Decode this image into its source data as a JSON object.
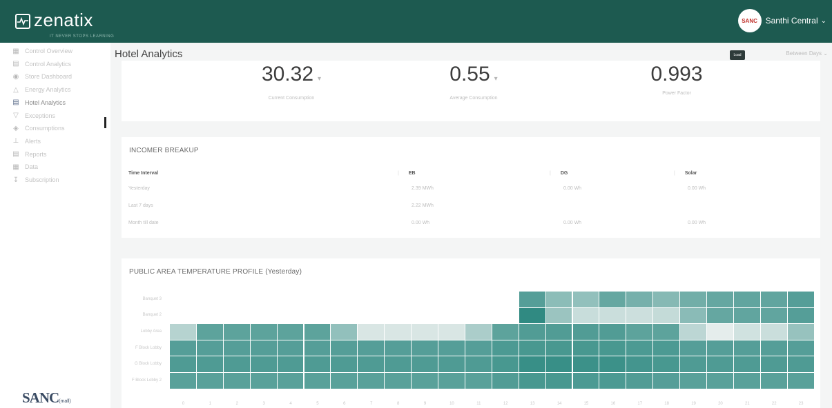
{
  "header": {
    "logo_text": "zenatix",
    "logo_tagline": "IT NEVER STOPS LEARNING",
    "user_name": "Santhi Central",
    "avatar_text": "SANC"
  },
  "sidebar": {
    "items": [
      {
        "label": "Control Overview",
        "icon": "building-icon"
      },
      {
        "label": "Control Analytics",
        "icon": "chart-icon"
      },
      {
        "label": "Store Dashboard",
        "icon": "store-icon"
      },
      {
        "label": "Energy Analytics",
        "icon": "bulb-icon"
      },
      {
        "label": "Hotel Analytics",
        "icon": "chart-icon",
        "active": true
      },
      {
        "label": "Exceptions",
        "icon": "filter-icon"
      },
      {
        "label": "Consumptions",
        "icon": "plug-icon"
      },
      {
        "label": "Alerts",
        "icon": "alert-icon"
      },
      {
        "label": "Reports",
        "icon": "report-icon"
      },
      {
        "label": "Data",
        "icon": "grid-icon"
      },
      {
        "label": "Subscription",
        "icon": "download-icon"
      }
    ],
    "footer_logo": "SANC",
    "footer_logo_sub": "(mall)"
  },
  "page": {
    "title": "Hotel Analytics",
    "top_button": "Load",
    "top_dropdown": "Between Days"
  },
  "kpis": [
    {
      "value": "30.32",
      "label": "Current Consumption",
      "has_arrow": true
    },
    {
      "value": "0.55",
      "label": "Average Consumption",
      "has_arrow": true
    },
    {
      "value": "0.993",
      "label": "Power Factor",
      "has_arrow": false
    }
  ],
  "breakup": {
    "title": "INCOMER BREAKUP",
    "columns": [
      "Time Interval",
      "EB",
      "DG",
      "Solar"
    ],
    "rows": [
      [
        "Yesterday",
        "2.39 MWh",
        "0.00 Wh",
        "0.00 Wh"
      ],
      [
        "Last 7 days",
        "2.22 MWh",
        "",
        ""
      ],
      [
        "Month till date",
        "0.00 Wh",
        "0.00 Wh",
        "0.00 Wh"
      ]
    ]
  },
  "heatmap": {
    "title": "PUBLIC AREA TEMPERATURE PROFILE (Yesterday)",
    "rows": [
      "Banquet 3",
      "Banquet 2",
      "Lobby Area",
      "F Block Lobby",
      "G Block Lobby",
      "F Block Lobby 2"
    ],
    "x_labels": [
      "0",
      "1",
      "2",
      "3",
      "4",
      "5",
      "6",
      "7",
      "8",
      "9",
      "10",
      "11",
      "12",
      "13",
      "14",
      "15",
      "16",
      "17",
      "18",
      "19",
      "20",
      "21",
      "22",
      "23"
    ],
    "colors": {
      "low": "#e9efee",
      "high": "#1b7f76"
    },
    "values": [
      [
        null,
        null,
        null,
        null,
        null,
        null,
        null,
        null,
        null,
        null,
        null,
        null,
        null,
        0.72,
        0.45,
        0.42,
        0.64,
        0.56,
        0.48,
        0.58,
        0.64,
        0.66,
        0.66,
        0.72
      ],
      [
        null,
        null,
        null,
        null,
        null,
        null,
        null,
        null,
        null,
        null,
        null,
        null,
        null,
        0.9,
        0.38,
        0.16,
        0.15,
        0.14,
        0.18,
        0.46,
        0.64,
        0.66,
        0.66,
        0.72
      ],
      [
        0.25,
        0.68,
        0.68,
        0.68,
        0.68,
        0.68,
        0.42,
        0.08,
        0.08,
        0.08,
        0.08,
        0.3,
        0.68,
        0.74,
        0.74,
        0.74,
        0.74,
        0.68,
        0.68,
        0.22,
        0.02,
        0.12,
        0.15,
        0.4
      ],
      [
        0.72,
        0.72,
        0.72,
        0.72,
        0.72,
        0.72,
        0.72,
        0.72,
        0.72,
        0.72,
        0.72,
        0.72,
        0.76,
        0.78,
        0.78,
        0.78,
        0.78,
        0.76,
        0.76,
        0.72,
        0.72,
        0.72,
        0.72,
        0.72
      ],
      [
        0.75,
        0.75,
        0.75,
        0.75,
        0.75,
        0.75,
        0.75,
        0.75,
        0.75,
        0.75,
        0.75,
        0.75,
        0.78,
        0.86,
        0.86,
        0.84,
        0.84,
        0.8,
        0.78,
        0.75,
        0.75,
        0.75,
        0.75,
        0.75
      ],
      [
        0.7,
        0.7,
        0.7,
        0.7,
        0.7,
        0.7,
        0.7,
        0.7,
        0.7,
        0.7,
        0.7,
        0.7,
        0.74,
        0.78,
        0.78,
        0.76,
        0.76,
        0.74,
        0.72,
        0.7,
        0.7,
        0.7,
        0.7,
        0.7
      ]
    ]
  }
}
